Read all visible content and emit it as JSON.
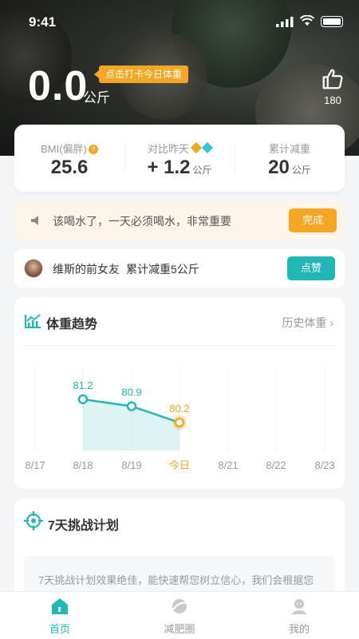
{
  "status_bar": {
    "time": "9:41"
  },
  "hero": {
    "weight_value": "0.0",
    "weight_unit": "公斤",
    "checkin_label": "点击打卡今日体重",
    "like_count": "180"
  },
  "stats": {
    "bmi_label": "BMI(偏胖)",
    "bmi_value": "25.6",
    "compare_label": "对比昨天",
    "compare_value": "+ 1.2",
    "compare_unit": "公斤",
    "total_label": "累计减重",
    "total_value": "20",
    "total_unit": "公斤"
  },
  "reminder": {
    "text": "该喝水了，一天必须喝水，非常重要",
    "button": "完成"
  },
  "feed": {
    "user": "维斯的前女友",
    "message": "累计减重5公斤",
    "button": "点赞"
  },
  "trend": {
    "title": "体重趋势",
    "history_link": "历史体重",
    "colors": {
      "accent": "#21b7b7",
      "today": "#f5a623"
    }
  },
  "chart_data": {
    "type": "line",
    "categories": [
      "8/17",
      "8/18",
      "8/19",
      "今日",
      "8/21",
      "8/22",
      "8/23"
    ],
    "values": [
      null,
      81.2,
      80.9,
      80.2,
      null,
      null,
      null
    ],
    "data_labels": [
      "",
      "81.2",
      "80.9",
      "80.2",
      "",
      "",
      ""
    ],
    "highlight_index": 3,
    "ylim": [
      79,
      82.5
    ],
    "grid": true
  },
  "plan": {
    "title": "7天挑战计划",
    "description": "7天挑战计划效果绝佳，能快速帮您树立信心，我们会根据您"
  },
  "tabbar": {
    "items": [
      {
        "label": "首页",
        "icon": "home-icon",
        "active": true
      },
      {
        "label": "减肥圈",
        "icon": "circle-icon",
        "active": false
      },
      {
        "label": "我的",
        "icon": "profile-icon",
        "active": false
      }
    ]
  }
}
